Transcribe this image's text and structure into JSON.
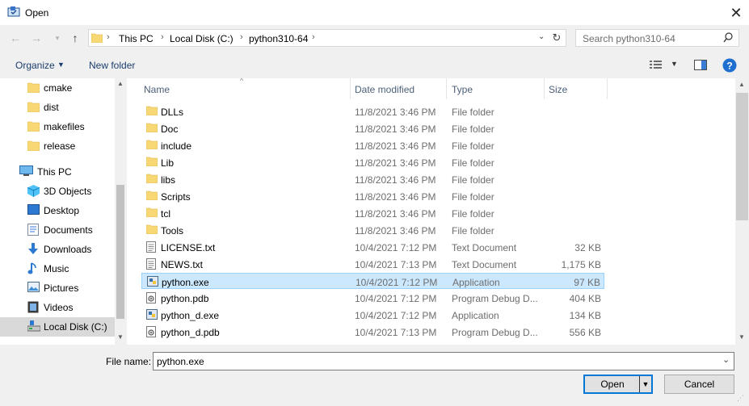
{
  "window": {
    "title": "Open"
  },
  "address": {
    "crumbs": [
      "This PC",
      "Local Disk (C:)",
      "python310-64"
    ]
  },
  "search": {
    "placeholder": "Search python310-64"
  },
  "toolbar": {
    "organize": "Organize",
    "new_folder": "New folder"
  },
  "nav": {
    "items": [
      {
        "label": "cmake",
        "icon": "folder-icon"
      },
      {
        "label": "dist",
        "icon": "folder-icon"
      },
      {
        "label": "makefiles",
        "icon": "folder-icon"
      },
      {
        "label": "release",
        "icon": "folder-icon"
      },
      {
        "label": "This PC",
        "icon": "computer-icon"
      },
      {
        "label": "3D Objects",
        "icon": "cube-icon"
      },
      {
        "label": "Desktop",
        "icon": "desktop-icon"
      },
      {
        "label": "Documents",
        "icon": "documents-icon"
      },
      {
        "label": "Downloads",
        "icon": "download-icon"
      },
      {
        "label": "Music",
        "icon": "music-icon"
      },
      {
        "label": "Pictures",
        "icon": "pictures-icon"
      },
      {
        "label": "Videos",
        "icon": "videos-icon"
      },
      {
        "label": "Local Disk (C:)",
        "icon": "drive-icon",
        "selected": true
      }
    ]
  },
  "columns": {
    "name": "Name",
    "date": "Date modified",
    "type": "Type",
    "size": "Size"
  },
  "files": [
    {
      "name": "DLLs",
      "date": "11/8/2021 3:46 PM",
      "type": "File folder",
      "size": "",
      "icon": "folder-icon"
    },
    {
      "name": "Doc",
      "date": "11/8/2021 3:46 PM",
      "type": "File folder",
      "size": "",
      "icon": "folder-icon"
    },
    {
      "name": "include",
      "date": "11/8/2021 3:46 PM",
      "type": "File folder",
      "size": "",
      "icon": "folder-icon"
    },
    {
      "name": "Lib",
      "date": "11/8/2021 3:46 PM",
      "type": "File folder",
      "size": "",
      "icon": "folder-icon"
    },
    {
      "name": "libs",
      "date": "11/8/2021 3:46 PM",
      "type": "File folder",
      "size": "",
      "icon": "folder-icon"
    },
    {
      "name": "Scripts",
      "date": "11/8/2021 3:46 PM",
      "type": "File folder",
      "size": "",
      "icon": "folder-icon"
    },
    {
      "name": "tcl",
      "date": "11/8/2021 3:46 PM",
      "type": "File folder",
      "size": "",
      "icon": "folder-icon"
    },
    {
      "name": "Tools",
      "date": "11/8/2021 3:46 PM",
      "type": "File folder",
      "size": "",
      "icon": "folder-icon"
    },
    {
      "name": "LICENSE.txt",
      "date": "10/4/2021 7:12 PM",
      "type": "Text Document",
      "size": "32 KB",
      "icon": "text-file-icon"
    },
    {
      "name": "NEWS.txt",
      "date": "10/4/2021 7:13 PM",
      "type": "Text Document",
      "size": "1,175 KB",
      "icon": "text-file-icon"
    },
    {
      "name": "python.exe",
      "date": "10/4/2021 7:12 PM",
      "type": "Application",
      "size": "97 KB",
      "icon": "python-exe-icon",
      "selected": true
    },
    {
      "name": "python.pdb",
      "date": "10/4/2021 7:12 PM",
      "type": "Program Debug D...",
      "size": "404 KB",
      "icon": "pdb-file-icon"
    },
    {
      "name": "python_d.exe",
      "date": "10/4/2021 7:12 PM",
      "type": "Application",
      "size": "134 KB",
      "icon": "python-exe-icon"
    },
    {
      "name": "python_d.pdb",
      "date": "10/4/2021 7:13 PM",
      "type": "Program Debug D...",
      "size": "556 KB",
      "icon": "pdb-file-icon"
    }
  ],
  "bottom": {
    "filename_label": "File name:",
    "filename_value": "python.exe",
    "open": "Open",
    "cancel": "Cancel"
  },
  "colors": {
    "accent": "#0078d7",
    "selection": "#cce8ff",
    "folder": "#f8d775"
  }
}
